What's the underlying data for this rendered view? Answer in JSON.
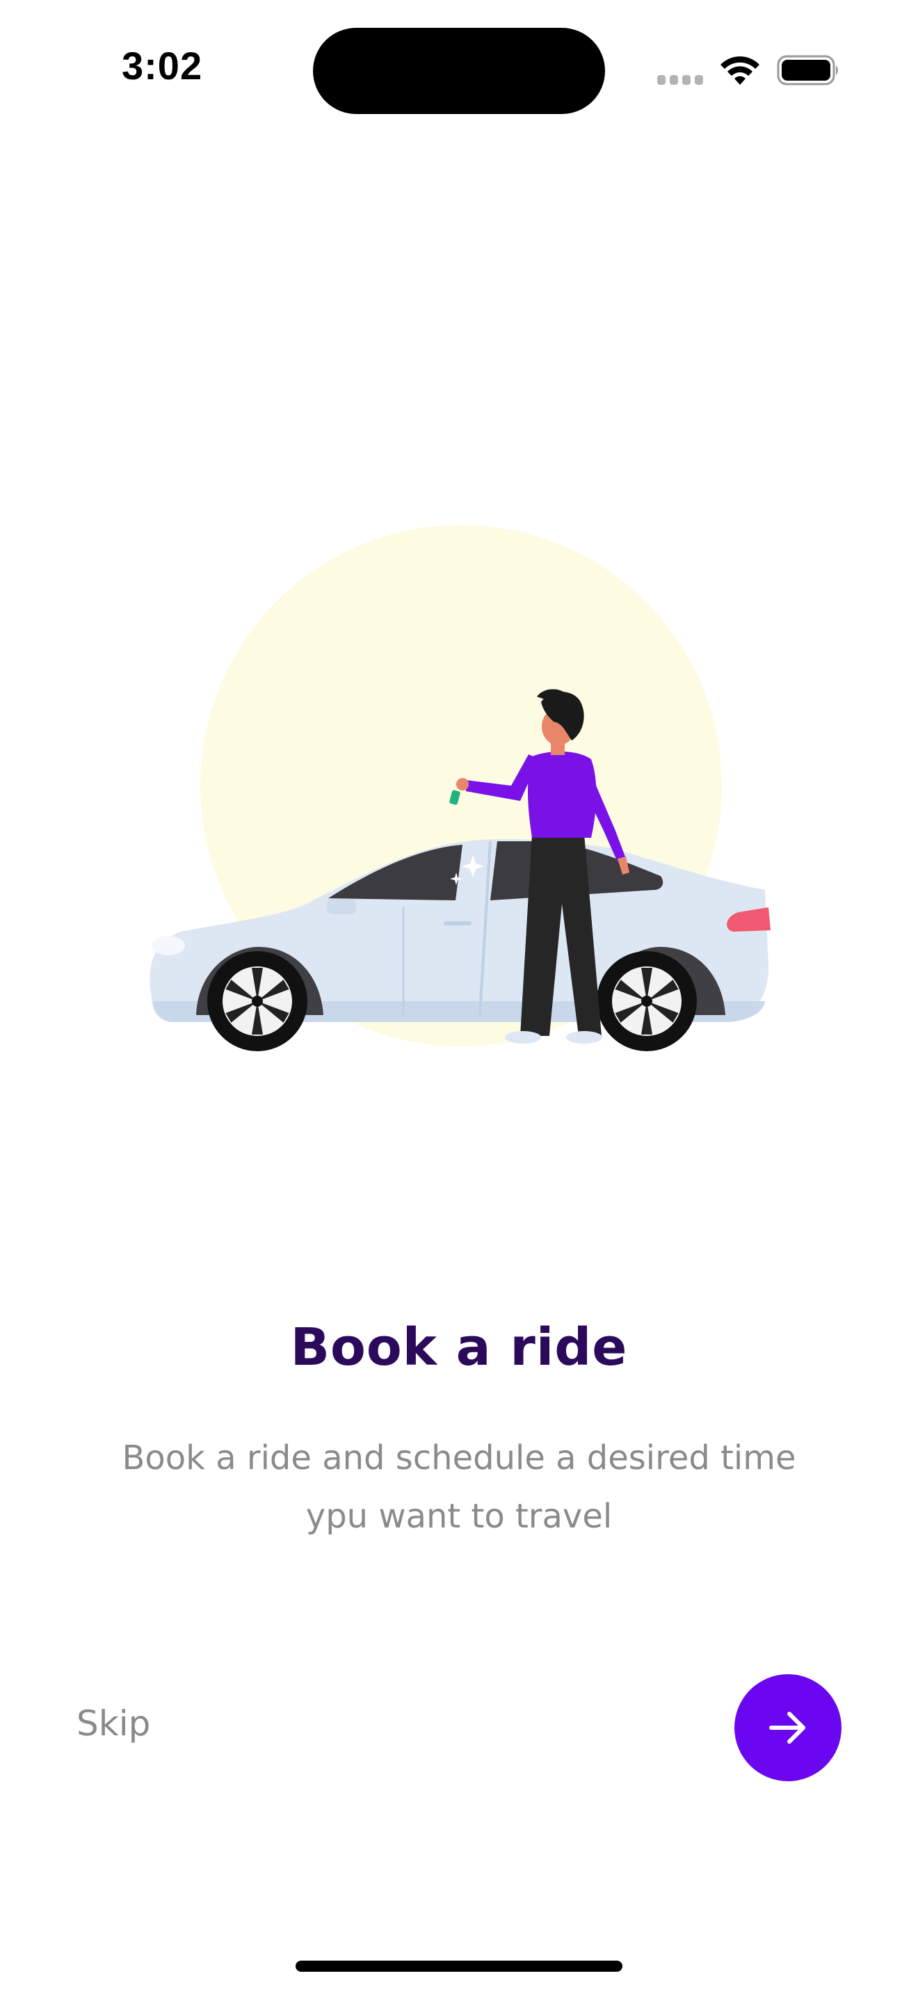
{
  "status_bar": {
    "time": "3:02",
    "icons": [
      "signal-icon",
      "wifi-icon",
      "battery-icon"
    ]
  },
  "onboarding": {
    "illustration": "person-with-car-illustration",
    "title": "Book a ride",
    "description_line1": "Book a ride and schedule a desired time",
    "description_line2": "ypu want to travel"
  },
  "controls": {
    "skip_label": "Skip",
    "next_icon": "arrow-right-icon"
  },
  "colors": {
    "accent": "#6a06f0",
    "title": "#2b0a5c",
    "body_text": "#8a8a8a",
    "illustration_sun": "#fdfbe2"
  }
}
